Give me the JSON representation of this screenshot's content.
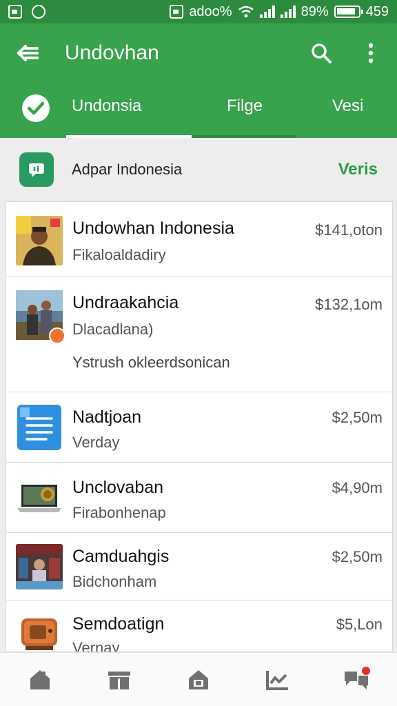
{
  "status_bar": {
    "network_text": "adoo%",
    "battery_text": "89%",
    "time": "459"
  },
  "toolbar": {
    "title": "Undovhan"
  },
  "tabs": [
    {
      "label": "Undonsia",
      "active": true
    },
    {
      "label": "Filge",
      "active": false
    },
    {
      "label": "Vesi",
      "active": false
    }
  ],
  "filter": {
    "label": "Adpar Indonesia",
    "action": "Veris"
  },
  "items": [
    {
      "title": "Undowhan Indonesia",
      "subtitle": "Fikaloaldadiry",
      "price": "$141,oton",
      "extra": ""
    },
    {
      "title": "Undraakahcia",
      "subtitle": "Dlacadlana)",
      "price": "$132,1om",
      "extra": "Ystrush okleerdsonican"
    },
    {
      "title": "Nadtjoan",
      "subtitle": "Verday",
      "price": "$2,50m",
      "extra": ""
    },
    {
      "title": "Unclovaban",
      "subtitle": "Firabonhenap",
      "price": "$4,90m",
      "extra": ""
    },
    {
      "title": "Camduahgis",
      "subtitle": "Bidchonham",
      "price": "$2,50m",
      "extra": ""
    },
    {
      "title": "Semdoatign",
      "subtitle": "Vernay",
      "price": "$5,Lon",
      "extra": ""
    }
  ],
  "colors": {
    "status_bar": "#2c8b3f",
    "app_bar": "#38a24c",
    "accent": "#2a9a4b"
  }
}
